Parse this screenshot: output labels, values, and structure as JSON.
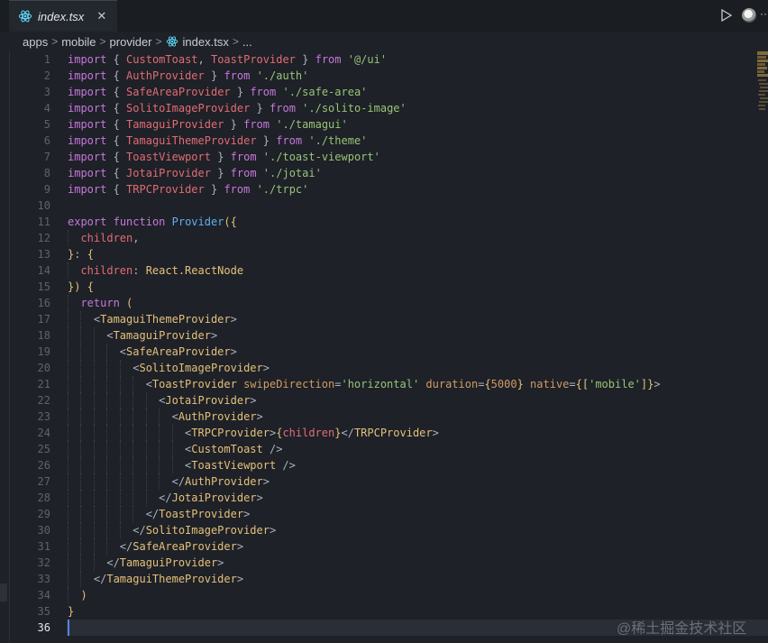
{
  "tab": {
    "filename": "index.tsx",
    "close_glyph": "✕"
  },
  "toolbar": {
    "more_glyph": "···"
  },
  "breadcrumb": [
    "apps",
    "mobile",
    "provider",
    "index.tsx",
    "..."
  ],
  "editor": {
    "active_line": 36,
    "lines": [
      [
        [
          "kw",
          "import"
        ],
        [
          "pun",
          " { "
        ],
        [
          "var",
          "CustomToast"
        ],
        [
          "pun",
          ", "
        ],
        [
          "var",
          "ToastProvider"
        ],
        [
          "pun",
          " } "
        ],
        [
          "kw",
          "from"
        ],
        [
          "pun",
          " "
        ],
        [
          "str",
          "'@/ui'"
        ]
      ],
      [
        [
          "kw",
          "import"
        ],
        [
          "pun",
          " { "
        ],
        [
          "var",
          "AuthProvider"
        ],
        [
          "pun",
          " } "
        ],
        [
          "kw",
          "from"
        ],
        [
          "pun",
          " "
        ],
        [
          "str",
          "'./auth'"
        ]
      ],
      [
        [
          "kw",
          "import"
        ],
        [
          "pun",
          " { "
        ],
        [
          "var",
          "SafeAreaProvider"
        ],
        [
          "pun",
          " } "
        ],
        [
          "kw",
          "from"
        ],
        [
          "pun",
          " "
        ],
        [
          "str",
          "'./safe-area'"
        ]
      ],
      [
        [
          "kw",
          "import"
        ],
        [
          "pun",
          " { "
        ],
        [
          "var",
          "SolitoImageProvider"
        ],
        [
          "pun",
          " } "
        ],
        [
          "kw",
          "from"
        ],
        [
          "pun",
          " "
        ],
        [
          "str",
          "'./solito-image'"
        ]
      ],
      [
        [
          "kw",
          "import"
        ],
        [
          "pun",
          " { "
        ],
        [
          "var",
          "TamaguiProvider"
        ],
        [
          "pun",
          " } "
        ],
        [
          "kw",
          "from"
        ],
        [
          "pun",
          " "
        ],
        [
          "str",
          "'./tamagui'"
        ]
      ],
      [
        [
          "kw",
          "import"
        ],
        [
          "pun",
          " { "
        ],
        [
          "var",
          "TamaguiThemeProvider"
        ],
        [
          "pun",
          " } "
        ],
        [
          "kw",
          "from"
        ],
        [
          "pun",
          " "
        ],
        [
          "str",
          "'./theme'"
        ]
      ],
      [
        [
          "kw",
          "import"
        ],
        [
          "pun",
          " { "
        ],
        [
          "var",
          "ToastViewport"
        ],
        [
          "pun",
          " } "
        ],
        [
          "kw",
          "from"
        ],
        [
          "pun",
          " "
        ],
        [
          "str",
          "'./toast-viewport'"
        ]
      ],
      [
        [
          "kw",
          "import"
        ],
        [
          "pun",
          " { "
        ],
        [
          "var",
          "JotaiProvider"
        ],
        [
          "pun",
          " } "
        ],
        [
          "kw",
          "from"
        ],
        [
          "pun",
          " "
        ],
        [
          "str",
          "'./jotai'"
        ]
      ],
      [
        [
          "kw",
          "import"
        ],
        [
          "pun",
          " { "
        ],
        [
          "var",
          "TRPCProvider"
        ],
        [
          "pun",
          " } "
        ],
        [
          "kw",
          "from"
        ],
        [
          "pun",
          " "
        ],
        [
          "str",
          "'./trpc'"
        ]
      ],
      [],
      [
        [
          "kw",
          "export"
        ],
        [
          "pun",
          " "
        ],
        [
          "kw",
          "function"
        ],
        [
          "pun",
          " "
        ],
        [
          "fn",
          "Provider"
        ],
        [
          "paren",
          "({"
        ]
      ],
      [
        [
          "pun",
          "  "
        ],
        [
          "var",
          "children"
        ],
        [
          "pun",
          ","
        ]
      ],
      [
        [
          "paren",
          "}"
        ],
        [
          "pun",
          ": "
        ],
        [
          "paren",
          "{"
        ]
      ],
      [
        [
          "pun",
          "  "
        ],
        [
          "var",
          "children"
        ],
        [
          "pun",
          ": "
        ],
        [
          "cls",
          "React.ReactNode"
        ]
      ],
      [
        [
          "paren",
          "})"
        ],
        [
          "pun",
          " "
        ],
        [
          "paren",
          "{"
        ]
      ],
      [
        [
          "pun",
          "  "
        ],
        [
          "kw",
          "return"
        ],
        [
          "pun",
          " "
        ],
        [
          "paren",
          "("
        ]
      ],
      [
        [
          "pun",
          "    <"
        ],
        [
          "tag",
          "TamaguiThemeProvider"
        ],
        [
          "pun",
          ">"
        ]
      ],
      [
        [
          "pun",
          "      <"
        ],
        [
          "tag",
          "TamaguiProvider"
        ],
        [
          "pun",
          ">"
        ]
      ],
      [
        [
          "pun",
          "        <"
        ],
        [
          "tag",
          "SafeAreaProvider"
        ],
        [
          "pun",
          ">"
        ]
      ],
      [
        [
          "pun",
          "          <"
        ],
        [
          "tag",
          "SolitoImageProvider"
        ],
        [
          "pun",
          ">"
        ]
      ],
      [
        [
          "pun",
          "            <"
        ],
        [
          "tag",
          "ToastProvider"
        ],
        [
          "pun",
          " "
        ],
        [
          "attr",
          "swipeDirection"
        ],
        [
          "pun",
          "="
        ],
        [
          "str",
          "'horizontal'"
        ],
        [
          "pun",
          " "
        ],
        [
          "attr",
          "duration"
        ],
        [
          "pun",
          "="
        ],
        [
          "paren",
          "{"
        ],
        [
          "num",
          "5000"
        ],
        [
          "paren",
          "}"
        ],
        [
          "pun",
          " "
        ],
        [
          "attr",
          "native"
        ],
        [
          "pun",
          "="
        ],
        [
          "paren",
          "{["
        ],
        [
          "str",
          "'mobile'"
        ],
        [
          "paren",
          "]}"
        ],
        [
          "pun",
          ">"
        ]
      ],
      [
        [
          "pun",
          "              <"
        ],
        [
          "tag",
          "JotaiProvider"
        ],
        [
          "pun",
          ">"
        ]
      ],
      [
        [
          "pun",
          "                <"
        ],
        [
          "tag",
          "AuthProvider"
        ],
        [
          "pun",
          ">"
        ]
      ],
      [
        [
          "pun",
          "                  <"
        ],
        [
          "tag",
          "TRPCProvider"
        ],
        [
          "pun",
          ">"
        ],
        [
          "paren",
          "{"
        ],
        [
          "var",
          "children"
        ],
        [
          "paren",
          "}"
        ],
        [
          "pun",
          "</"
        ],
        [
          "tag",
          "TRPCProvider"
        ],
        [
          "pun",
          ">"
        ]
      ],
      [
        [
          "pun",
          "                  <"
        ],
        [
          "tag",
          "CustomToast"
        ],
        [
          "pun",
          " />"
        ]
      ],
      [
        [
          "pun",
          "                  <"
        ],
        [
          "tag",
          "ToastViewport"
        ],
        [
          "pun",
          " />"
        ]
      ],
      [
        [
          "pun",
          "                </"
        ],
        [
          "tag",
          "AuthProvider"
        ],
        [
          "pun",
          ">"
        ]
      ],
      [
        [
          "pun",
          "              </"
        ],
        [
          "tag",
          "JotaiProvider"
        ],
        [
          "pun",
          ">"
        ]
      ],
      [
        [
          "pun",
          "            </"
        ],
        [
          "tag",
          "ToastProvider"
        ],
        [
          "pun",
          ">"
        ]
      ],
      [
        [
          "pun",
          "          </"
        ],
        [
          "tag",
          "SolitoImageProvider"
        ],
        [
          "pun",
          ">"
        ]
      ],
      [
        [
          "pun",
          "        </"
        ],
        [
          "tag",
          "SafeAreaProvider"
        ],
        [
          "pun",
          ">"
        ]
      ],
      [
        [
          "pun",
          "      </"
        ],
        [
          "tag",
          "TamaguiProvider"
        ],
        [
          "pun",
          ">"
        ]
      ],
      [
        [
          "pun",
          "    </"
        ],
        [
          "tag",
          "TamaguiThemeProvider"
        ],
        [
          "pun",
          ">"
        ]
      ],
      [
        [
          "pun",
          "  "
        ],
        [
          "paren",
          ")"
        ]
      ],
      [
        [
          "paren",
          "}"
        ]
      ],
      []
    ]
  },
  "watermark": "@稀土掘金技术社区"
}
